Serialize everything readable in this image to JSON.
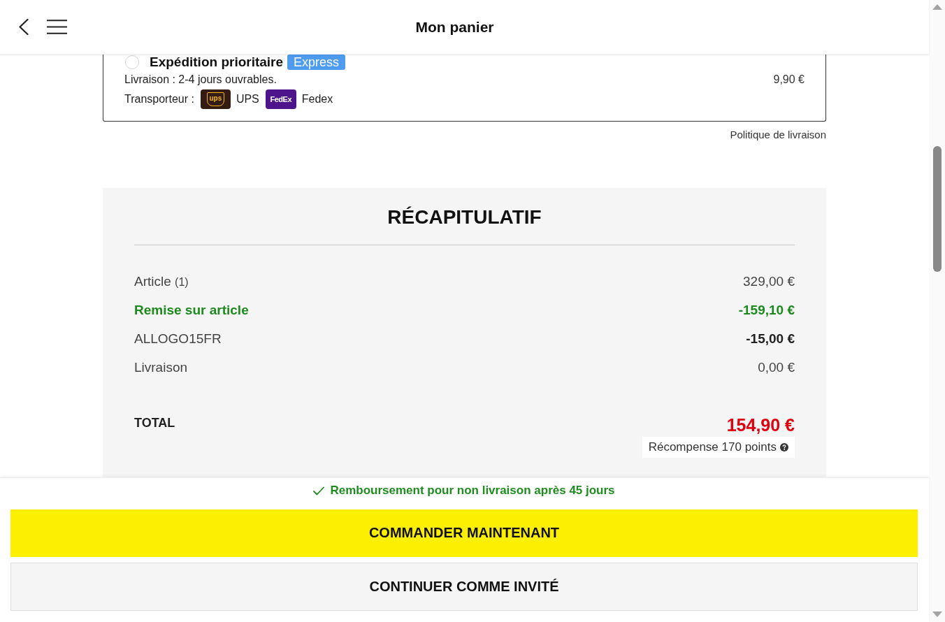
{
  "header": {
    "title": "Mon panier"
  },
  "shipping_option": {
    "selected": false,
    "title": "Expédition prioritaire",
    "badge": "Express",
    "delivery": "Livraison : 2-4 jours ouvrables.",
    "price": "9,90 €",
    "carrier_label": "Transporteur :",
    "carriers": [
      {
        "kind": "ups",
        "logo_text": "ups",
        "name": "UPS"
      },
      {
        "kind": "fedex",
        "logo_text": "FedEx",
        "name": "Fedex"
      }
    ]
  },
  "shipping_policy_link": "Politique de livraison",
  "summary": {
    "title": "RÉCAPITULATIF",
    "rows": [
      {
        "kind": "plain",
        "label": "Article",
        "count": "(1)",
        "value": "329,00 €"
      },
      {
        "kind": "discount",
        "label": "Remise sur article",
        "value": "-159,10 €"
      },
      {
        "kind": "coupon",
        "label": "ALLOGO15FR",
        "value": "-15,00 €"
      },
      {
        "kind": "plain",
        "label": "Livraison",
        "value": "0,00 €"
      }
    ],
    "total": {
      "label": "TOTAL",
      "value": "154,90 €"
    },
    "reward": "Récompense 170 points"
  },
  "footer": {
    "guarantee": "Remboursement pour non livraison après 45 jours",
    "buttons": [
      {
        "kind": "primary",
        "label": "COMMANDER MAINTENANT"
      },
      {
        "kind": "secondary",
        "label": "CONTINUER COMME INVITÉ"
      }
    ]
  }
}
